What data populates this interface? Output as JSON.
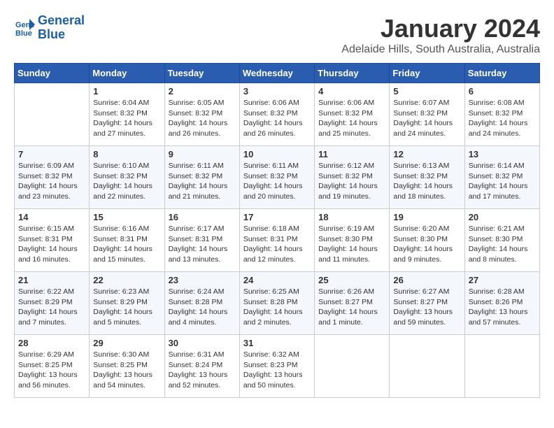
{
  "logo": {
    "line1": "General",
    "line2": "Blue"
  },
  "title": "January 2024",
  "subtitle": "Adelaide Hills, South Australia, Australia",
  "days_of_week": [
    "Sunday",
    "Monday",
    "Tuesday",
    "Wednesday",
    "Thursday",
    "Friday",
    "Saturday"
  ],
  "weeks": [
    [
      {
        "day": "",
        "sunrise": "",
        "sunset": "",
        "daylight": ""
      },
      {
        "day": "1",
        "sunrise": "Sunrise: 6:04 AM",
        "sunset": "Sunset: 8:32 PM",
        "daylight": "Daylight: 14 hours and 27 minutes."
      },
      {
        "day": "2",
        "sunrise": "Sunrise: 6:05 AM",
        "sunset": "Sunset: 8:32 PM",
        "daylight": "Daylight: 14 hours and 26 minutes."
      },
      {
        "day": "3",
        "sunrise": "Sunrise: 6:06 AM",
        "sunset": "Sunset: 8:32 PM",
        "daylight": "Daylight: 14 hours and 26 minutes."
      },
      {
        "day": "4",
        "sunrise": "Sunrise: 6:06 AM",
        "sunset": "Sunset: 8:32 PM",
        "daylight": "Daylight: 14 hours and 25 minutes."
      },
      {
        "day": "5",
        "sunrise": "Sunrise: 6:07 AM",
        "sunset": "Sunset: 8:32 PM",
        "daylight": "Daylight: 14 hours and 24 minutes."
      },
      {
        "day": "6",
        "sunrise": "Sunrise: 6:08 AM",
        "sunset": "Sunset: 8:32 PM",
        "daylight": "Daylight: 14 hours and 24 minutes."
      }
    ],
    [
      {
        "day": "7",
        "sunrise": "Sunrise: 6:09 AM",
        "sunset": "Sunset: 8:32 PM",
        "daylight": "Daylight: 14 hours and 23 minutes."
      },
      {
        "day": "8",
        "sunrise": "Sunrise: 6:10 AM",
        "sunset": "Sunset: 8:32 PM",
        "daylight": "Daylight: 14 hours and 22 minutes."
      },
      {
        "day": "9",
        "sunrise": "Sunrise: 6:11 AM",
        "sunset": "Sunset: 8:32 PM",
        "daylight": "Daylight: 14 hours and 21 minutes."
      },
      {
        "day": "10",
        "sunrise": "Sunrise: 6:11 AM",
        "sunset": "Sunset: 8:32 PM",
        "daylight": "Daylight: 14 hours and 20 minutes."
      },
      {
        "day": "11",
        "sunrise": "Sunrise: 6:12 AM",
        "sunset": "Sunset: 8:32 PM",
        "daylight": "Daylight: 14 hours and 19 minutes."
      },
      {
        "day": "12",
        "sunrise": "Sunrise: 6:13 AM",
        "sunset": "Sunset: 8:32 PM",
        "daylight": "Daylight: 14 hours and 18 minutes."
      },
      {
        "day": "13",
        "sunrise": "Sunrise: 6:14 AM",
        "sunset": "Sunset: 8:32 PM",
        "daylight": "Daylight: 14 hours and 17 minutes."
      }
    ],
    [
      {
        "day": "14",
        "sunrise": "Sunrise: 6:15 AM",
        "sunset": "Sunset: 8:31 PM",
        "daylight": "Daylight: 14 hours and 16 minutes."
      },
      {
        "day": "15",
        "sunrise": "Sunrise: 6:16 AM",
        "sunset": "Sunset: 8:31 PM",
        "daylight": "Daylight: 14 hours and 15 minutes."
      },
      {
        "day": "16",
        "sunrise": "Sunrise: 6:17 AM",
        "sunset": "Sunset: 8:31 PM",
        "daylight": "Daylight: 14 hours and 13 minutes."
      },
      {
        "day": "17",
        "sunrise": "Sunrise: 6:18 AM",
        "sunset": "Sunset: 8:31 PM",
        "daylight": "Daylight: 14 hours and 12 minutes."
      },
      {
        "day": "18",
        "sunrise": "Sunrise: 6:19 AM",
        "sunset": "Sunset: 8:30 PM",
        "daylight": "Daylight: 14 hours and 11 minutes."
      },
      {
        "day": "19",
        "sunrise": "Sunrise: 6:20 AM",
        "sunset": "Sunset: 8:30 PM",
        "daylight": "Daylight: 14 hours and 9 minutes."
      },
      {
        "day": "20",
        "sunrise": "Sunrise: 6:21 AM",
        "sunset": "Sunset: 8:30 PM",
        "daylight": "Daylight: 14 hours and 8 minutes."
      }
    ],
    [
      {
        "day": "21",
        "sunrise": "Sunrise: 6:22 AM",
        "sunset": "Sunset: 8:29 PM",
        "daylight": "Daylight: 14 hours and 7 minutes."
      },
      {
        "day": "22",
        "sunrise": "Sunrise: 6:23 AM",
        "sunset": "Sunset: 8:29 PM",
        "daylight": "Daylight: 14 hours and 5 minutes."
      },
      {
        "day": "23",
        "sunrise": "Sunrise: 6:24 AM",
        "sunset": "Sunset: 8:28 PM",
        "daylight": "Daylight: 14 hours and 4 minutes."
      },
      {
        "day": "24",
        "sunrise": "Sunrise: 6:25 AM",
        "sunset": "Sunset: 8:28 PM",
        "daylight": "Daylight: 14 hours and 2 minutes."
      },
      {
        "day": "25",
        "sunrise": "Sunrise: 6:26 AM",
        "sunset": "Sunset: 8:27 PM",
        "daylight": "Daylight: 14 hours and 1 minute."
      },
      {
        "day": "26",
        "sunrise": "Sunrise: 6:27 AM",
        "sunset": "Sunset: 8:27 PM",
        "daylight": "Daylight: 13 hours and 59 minutes."
      },
      {
        "day": "27",
        "sunrise": "Sunrise: 6:28 AM",
        "sunset": "Sunset: 8:26 PM",
        "daylight": "Daylight: 13 hours and 57 minutes."
      }
    ],
    [
      {
        "day": "28",
        "sunrise": "Sunrise: 6:29 AM",
        "sunset": "Sunset: 8:25 PM",
        "daylight": "Daylight: 13 hours and 56 minutes."
      },
      {
        "day": "29",
        "sunrise": "Sunrise: 6:30 AM",
        "sunset": "Sunset: 8:25 PM",
        "daylight": "Daylight: 13 hours and 54 minutes."
      },
      {
        "day": "30",
        "sunrise": "Sunrise: 6:31 AM",
        "sunset": "Sunset: 8:24 PM",
        "daylight": "Daylight: 13 hours and 52 minutes."
      },
      {
        "day": "31",
        "sunrise": "Sunrise: 6:32 AM",
        "sunset": "Sunset: 8:23 PM",
        "daylight": "Daylight: 13 hours and 50 minutes."
      },
      {
        "day": "",
        "sunrise": "",
        "sunset": "",
        "daylight": ""
      },
      {
        "day": "",
        "sunrise": "",
        "sunset": "",
        "daylight": ""
      },
      {
        "day": "",
        "sunrise": "",
        "sunset": "",
        "daylight": ""
      }
    ]
  ]
}
